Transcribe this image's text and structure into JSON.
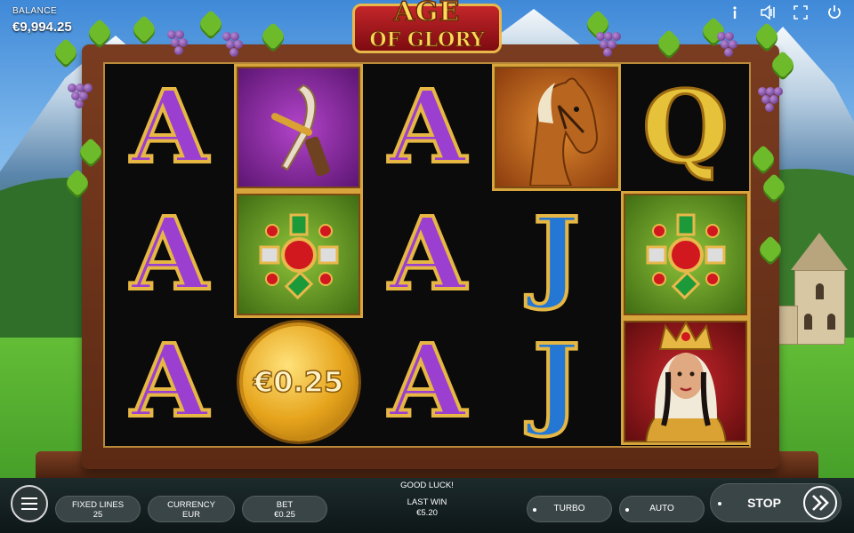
{
  "hud": {
    "balance_label": "BALANCE",
    "balance_value": "€9,994.25",
    "icons": [
      "info-icon",
      "sound-icon",
      "fullscreen-icon",
      "power-icon"
    ]
  },
  "logo": {
    "line1": "AGE",
    "line2": "OF GLORY"
  },
  "reels": [
    [
      {
        "symbol": "A"
      },
      {
        "symbol": "A"
      },
      {
        "symbol": "A"
      }
    ],
    [
      {
        "symbol": "sword"
      },
      {
        "symbol": "jewel"
      },
      {
        "symbol": "coin",
        "text": "€0.25"
      }
    ],
    [
      {
        "symbol": "A"
      },
      {
        "symbol": "A"
      },
      {
        "symbol": "A"
      }
    ],
    [
      {
        "symbol": "horse"
      },
      {
        "symbol": "J"
      },
      {
        "symbol": "J"
      }
    ],
    [
      {
        "symbol": "Q"
      },
      {
        "symbol": "jewel"
      },
      {
        "symbol": "queen"
      }
    ]
  ],
  "bottom": {
    "message": "GOOD LUCK!",
    "fixed_lines_label": "FIXED LINES",
    "fixed_lines_value": "25",
    "currency_label": "CURRENCY",
    "currency_value": "EUR",
    "bet_label": "BET",
    "bet_value": "€0.25",
    "last_win_label": "LAST WIN",
    "last_win_value": "€5.20",
    "turbo_label": "TURBO",
    "auto_label": "AUTO",
    "stop_label": "STOP"
  },
  "colors": {
    "accent_gold": "#e6b743",
    "frame_wood": "#6b3219",
    "bar_bg": "#142022"
  }
}
